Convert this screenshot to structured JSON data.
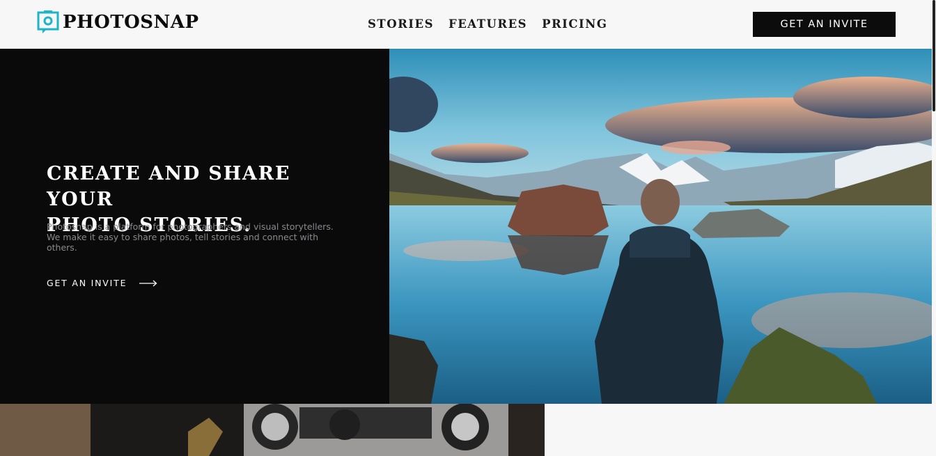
{
  "brand": {
    "name": "PHOTOSNAP"
  },
  "nav": {
    "items": [
      "STORIES",
      "FEATURES",
      "PRICING"
    ]
  },
  "header": {
    "cta_label": "GET AN INVITE"
  },
  "hero": {
    "title": "CREATE AND SHARE YOUR\nPHOTO STORIES.",
    "description": "Photosnap is a platform for photographers and visual storytellers. We make it easy to share photos, tell stories and connect with others.",
    "link_label": "GET AN INVITE",
    "image_alt": "man-looking-at-mountain-lake",
    "arrow_icon": "arrow-right-icon"
  },
  "colors": {
    "accent": "#1bb5c8",
    "dark": "#0a0a0b",
    "light": "#f7f7f7"
  }
}
